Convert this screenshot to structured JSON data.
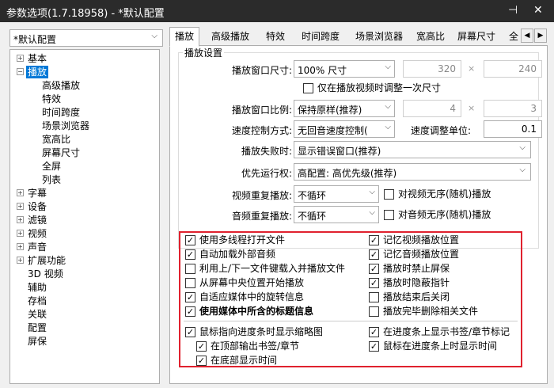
{
  "window": {
    "title": "参数选项(1.7.18958) - *默认配置",
    "pin_glyph": "⊣",
    "close_glyph": "✕"
  },
  "profile": {
    "value": "*默认配置"
  },
  "tree": {
    "items": [
      {
        "label": "基本"
      },
      {
        "label": "播放"
      },
      {
        "label": "高级播放"
      },
      {
        "label": "特效"
      },
      {
        "label": "时间跨度"
      },
      {
        "label": "场景浏览器"
      },
      {
        "label": "宽高比"
      },
      {
        "label": "屏幕尺寸"
      },
      {
        "label": "全屏"
      },
      {
        "label": "列表"
      },
      {
        "label": "字幕"
      },
      {
        "label": "设备"
      },
      {
        "label": "滤镜"
      },
      {
        "label": "视频"
      },
      {
        "label": "声音"
      },
      {
        "label": "扩展功能"
      },
      {
        "label": "3D 视频"
      },
      {
        "label": "辅助"
      },
      {
        "label": "存档"
      },
      {
        "label": "关联"
      },
      {
        "label": "配置"
      },
      {
        "label": "屏保"
      }
    ],
    "selected": "播放"
  },
  "tabs": [
    "播放",
    "高级播放",
    "特效",
    "时间跨度",
    "场景浏览器",
    "宽高比",
    "屏幕尺寸",
    "全"
  ],
  "playback": {
    "group_title": "播放设置",
    "window_size": {
      "label": "播放窗口尺寸:",
      "value": "100% 尺寸",
      "w": "320",
      "h": "240"
    },
    "resize_once": {
      "label": "仅在播放视频时调整一次尺寸",
      "checked": false
    },
    "window_ratio": {
      "label": "播放窗口比例:",
      "value": "保持原样(推荐)",
      "a": "4",
      "b": "3"
    },
    "speed_mode": {
      "label": "速度控制方式:",
      "value": "无回音速度控制(",
      "unit_label": "速度调整单位:",
      "unit_value": "0.1"
    },
    "on_fail": {
      "label": "播放失败时:",
      "value": "显示错误窗口(推荐)"
    },
    "priority": {
      "label": "优先运行权:",
      "value": "高配置: 高优先级(推荐)"
    },
    "video_repeat": {
      "label": "视频重复播放:",
      "value": "不循环",
      "check_label": "对视频无序(随机)播放",
      "checked": false
    },
    "audio_repeat": {
      "label": "音频重复播放:",
      "value": "不循环",
      "check_label": "对音频无序(随机)播放",
      "checked": false
    }
  },
  "options": {
    "left": [
      {
        "label": "使用多线程打开文件",
        "checked": true
      },
      {
        "label": "自动加载外部音频",
        "checked": true
      },
      {
        "label": "利用上/下一文件键载入并播放文件",
        "checked": false
      },
      {
        "label": "从屏幕中央位置开始播放",
        "checked": false
      },
      {
        "label": "自适应媒体中的旋转信息",
        "checked": true
      },
      {
        "label": "使用媒体中所含的标题信息",
        "checked": true
      }
    ],
    "right": [
      {
        "label": "记忆视频播放位置",
        "checked": true
      },
      {
        "label": "记忆音频播放位置",
        "checked": true
      },
      {
        "label": "播放时禁止屏保",
        "checked": true
      },
      {
        "label": "播放时隐蔽指针",
        "checked": true
      },
      {
        "label": "播放结束后关闭",
        "checked": false
      },
      {
        "label": "播放完毕删除相关文件",
        "checked": false
      }
    ]
  },
  "seekbar": {
    "thumbnail": {
      "label": "鼠标指向进度条时显示缩略图",
      "checked": true
    },
    "show_chapters": {
      "label": "在进度条上显示书签/章节标记",
      "checked": true
    },
    "output_top": {
      "label": "在顶部输出书签/章节",
      "checked": true
    },
    "show_time": {
      "label": "鼠标在进度条上时显示时间",
      "checked": true
    },
    "bottom_time": {
      "label": "在底部显示时间",
      "checked": true
    }
  },
  "colors": {
    "accent": "#0078d7",
    "highlight_border": "#e0212e",
    "titlebar": "#2b2b2b"
  },
  "glyphs": {
    "check": "✓",
    "dropdown": "⌵",
    "times": "×"
  }
}
